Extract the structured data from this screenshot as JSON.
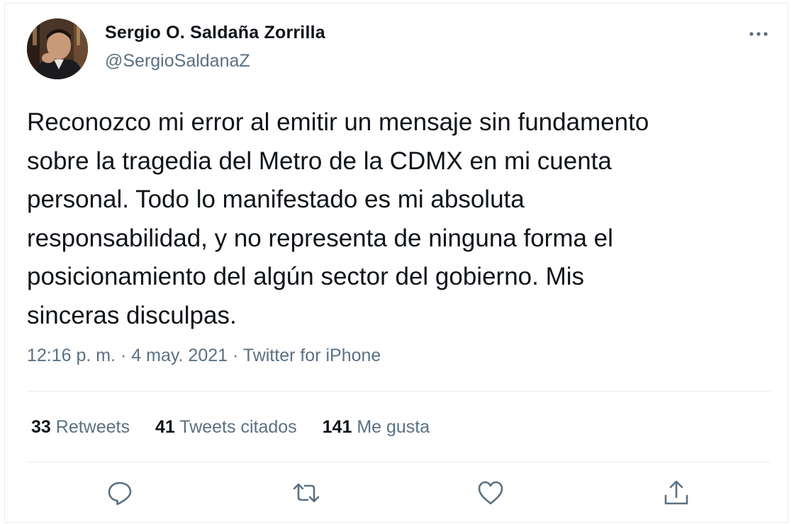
{
  "author": {
    "name": "Sergio O. Saldaña Zorrilla",
    "handle": "@SergioSaldanaZ"
  },
  "tweet": {
    "text_lines": [
      "Reconozco mi error al emitir un mensaje sin fundamento",
      "sobre la tragedia del Metro de la CDMX en mi cuenta",
      "personal. Todo lo manifestado es mi absoluta",
      "responsabilidad, y no representa de ninguna forma el",
      "posicionamiento del algún sector del gobierno. Mis",
      "sinceras disculpas."
    ],
    "time": "12:16 p. m.",
    "date": "4 may. 2021",
    "separator": " · ",
    "source": "Twitter for iPhone"
  },
  "stats": {
    "retweets": {
      "count": "33",
      "label": "Retweets"
    },
    "quotes": {
      "count": "41",
      "label": "Tweets citados"
    },
    "likes": {
      "count": "141",
      "label": "Me gusta"
    }
  },
  "icons": {
    "more": "more-horizontal-icon",
    "reply": "reply-icon",
    "retweet": "retweet-icon",
    "like": "heart-icon",
    "share": "share-icon"
  },
  "colors": {
    "text": "#0f1419",
    "secondary": "#5b7083",
    "border": "#e6ecf0"
  }
}
